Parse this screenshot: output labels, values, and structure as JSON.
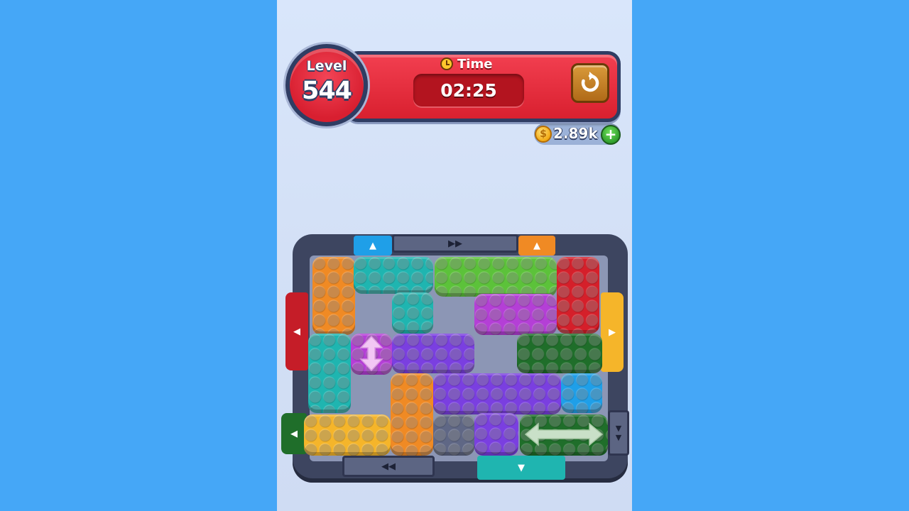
{
  "hud": {
    "level_label": "Level",
    "level_number": "544",
    "time_label": "Time",
    "time_value": "02:25",
    "coins": "2.89k",
    "add_coins_symbol": "+"
  },
  "icons": {
    "clock": "clock-icon",
    "restart": "restart-icon",
    "coin": "coin-icon",
    "add": "plus-icon"
  },
  "gate_symbols": {
    "blue_top": "▲",
    "orange_top": "▲",
    "gray_top": "▶▶",
    "red_left": "◀",
    "yellow_right": "▶",
    "green_left": "◀",
    "gray_bottom": "◀◀",
    "teal_bottom": "▼",
    "green_right": "▼▼"
  },
  "colors": {
    "background": "#45a7f7",
    "hud_red": "#e5283a",
    "hud_outline": "#2f3d63",
    "orange": "#f08a24",
    "teal": "#1fb5b0",
    "green": "#5cc23a",
    "dark_green": "#1f6e2a",
    "red": "#d51f2a",
    "magenta": "#b43fd6",
    "purple": "#7a3fe0",
    "yellow": "#f5b52a",
    "blue": "#1f9fe8",
    "gray": "#5f6785"
  }
}
